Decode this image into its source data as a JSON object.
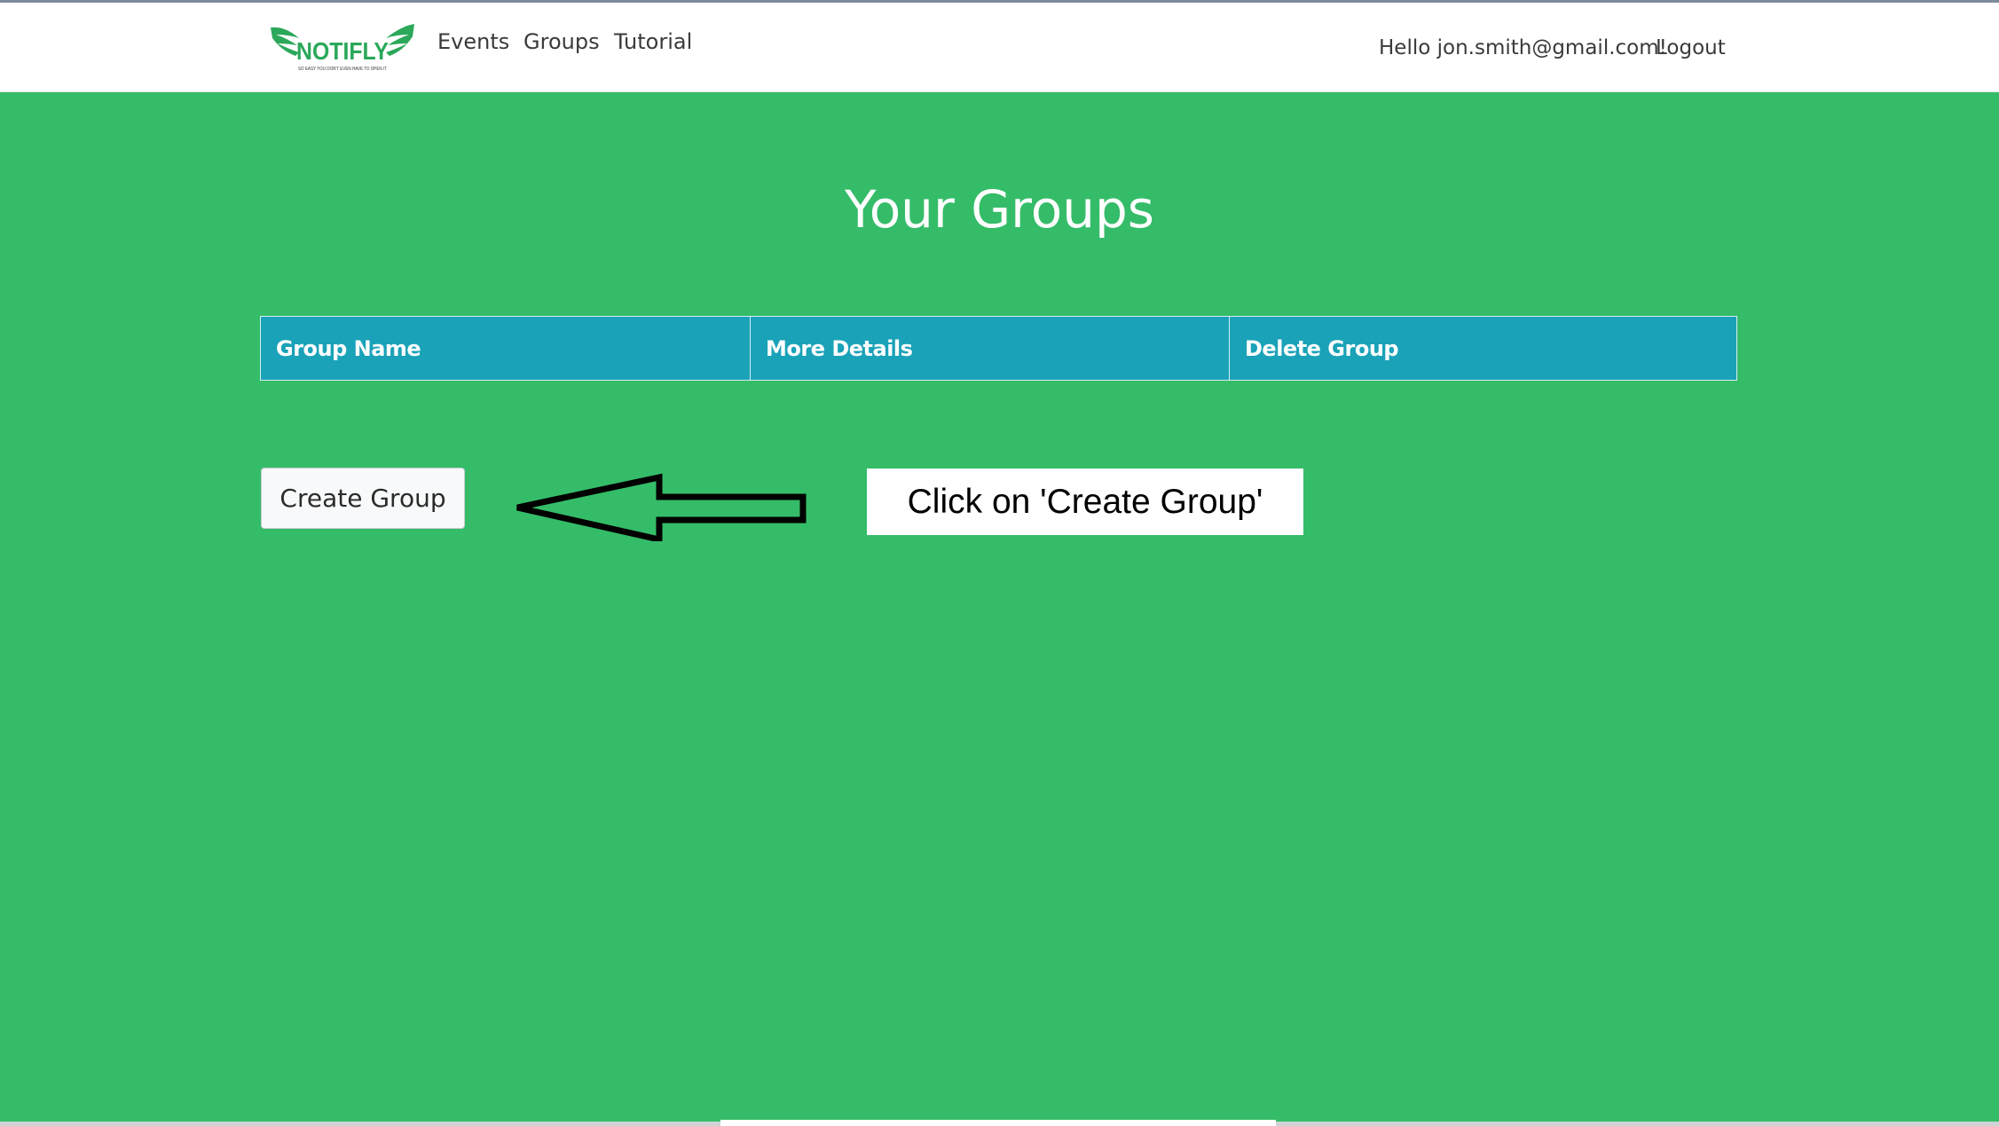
{
  "colors": {
    "page_background": "#35bc69",
    "navbar_background": "#ffffff",
    "table_header_background": "#1aa2b8",
    "logo_green": "#2ba85a",
    "callout_background": "#ffffff"
  },
  "navbar": {
    "logo_text": "NOTIFLY",
    "logo_tagline": "SO EASY YOU DON'T EVEN HAVE TO OPEN IT",
    "links": [
      "Events",
      "Groups",
      "Tutorial"
    ],
    "greeting": "Hello jon.smith@gmail.com!",
    "logout_label": "Logout"
  },
  "main": {
    "title": "Your Groups",
    "table": {
      "columns": [
        "Group Name",
        "More Details",
        "Delete Group"
      ],
      "rows": []
    },
    "create_button_label": "Create Group"
  },
  "annotation": {
    "arrow_icon": "arrow-left-outline-icon",
    "callout_text": "Click on 'Create Group'"
  }
}
